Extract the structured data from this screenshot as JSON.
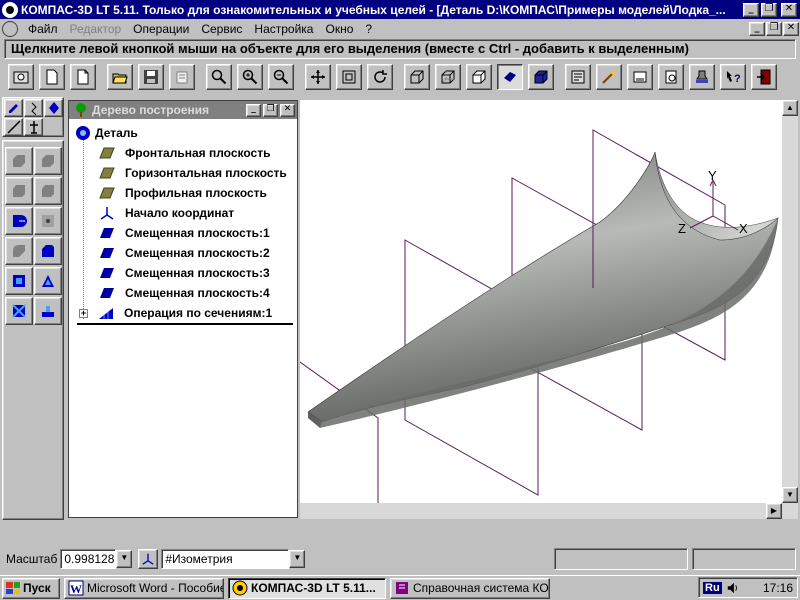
{
  "window": {
    "title": "КОМПАС-3D LT 5.11. Только для ознакомительных и учебных целей - [Деталь D:\\КОМПАС\\Примеры моделей\\Лодка_..."
  },
  "menu": [
    {
      "label": "Файл",
      "enabled": true
    },
    {
      "label": "Редактор",
      "enabled": false
    },
    {
      "label": "Операции",
      "enabled": true
    },
    {
      "label": "Сервис",
      "enabled": true
    },
    {
      "label": "Настройка",
      "enabled": true
    },
    {
      "label": "Окно",
      "enabled": true
    },
    {
      "label": "?",
      "enabled": true
    }
  ],
  "prompt": "Щелкните левой кнопкой мыши на объекте для его выделения (вместе с Ctrl - добавить к выделенным)",
  "toolbar": [
    "camera-icon",
    "new-sheet-icon",
    "new-part-icon",
    "open-folder-icon",
    "save-disk-icon",
    "print-preview-icon",
    "zoom-window-icon",
    "zoom-in-icon",
    "zoom-out-icon",
    "pan-icon",
    "fit-icon",
    "rotate-icon",
    "wireframe-icon",
    "hidden-lines-icon",
    "no-hidden-icon",
    "shaded-icon",
    "shaded-edges-icon",
    "mass-props-icon",
    "wizard-icon",
    "sheet-icon",
    "preview-icon",
    "stamp-icon",
    "help-icon",
    "exit-icon"
  ],
  "tree": {
    "caption": "Дерево построения",
    "root": "Деталь",
    "items": [
      {
        "label": "Фронтальная плоскость",
        "icon": "plane-icon"
      },
      {
        "label": "Горизонтальная плоскость",
        "icon": "plane-icon"
      },
      {
        "label": "Профильная плоскость",
        "icon": "plane-icon"
      },
      {
        "label": "Начало координат",
        "icon": "origin-icon"
      },
      {
        "label": "Смещенная плоскость:1",
        "icon": "offset-plane-icon"
      },
      {
        "label": "Смещенная плоскость:2",
        "icon": "offset-plane-icon"
      },
      {
        "label": "Смещенная плоскость:3",
        "icon": "offset-plane-icon"
      },
      {
        "label": "Смещенная плоскость:4",
        "icon": "offset-plane-icon"
      },
      {
        "label": "Операция по сечениям:1",
        "icon": "loft-icon"
      }
    ]
  },
  "axes": {
    "x": "X",
    "y": "Y",
    "z": "Z"
  },
  "status": {
    "scale_label": "Масштаб",
    "scale_value": "0.998128",
    "view_value": "#Изометрия"
  },
  "taskbar": {
    "start": "Пуск",
    "tasks": [
      {
        "label": "Microsoft Word - Пособие...",
        "active": false
      },
      {
        "label": "КОМПАС-3D LT 5.11...",
        "active": true
      },
      {
        "label": "Справочная система КО...",
        "active": false
      }
    ],
    "lang": "Ru",
    "clock": "17:16"
  },
  "colors": {
    "title_active": "#000080",
    "plane_icon": "#808040",
    "offset_plane_icon": "#0000a0",
    "plane_outline": "#5a1a5a",
    "surface": "#8c8f8c"
  }
}
